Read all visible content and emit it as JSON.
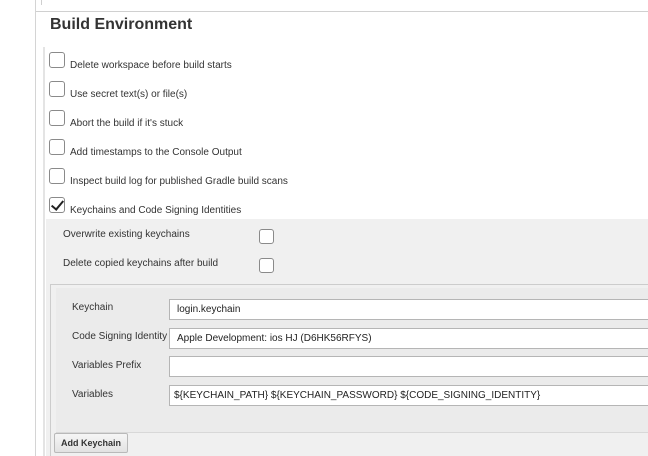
{
  "section": {
    "title": "Build Environment"
  },
  "options": [
    {
      "label": "Delete workspace before build starts",
      "checked": false
    },
    {
      "label": "Use secret text(s) or file(s)",
      "checked": false
    },
    {
      "label": "Abort the build if it's stuck",
      "checked": false
    },
    {
      "label": "Add timestamps to the Console Output",
      "checked": false
    },
    {
      "label": "Inspect build log for published Gradle build scans",
      "checked": false
    },
    {
      "label": "Keychains and Code Signing Identities",
      "checked": true
    }
  ],
  "keychain_settings": {
    "overwrite_label": "Overwrite existing keychains",
    "overwrite_checked": false,
    "delete_label": "Delete copied keychains after build",
    "delete_checked": false
  },
  "keychain_entry": {
    "keychain_label": "Keychain",
    "keychain_value": "login.keychain",
    "identity_label": "Code Signing Identity",
    "identity_value": "Apple Development: ios HJ (D6HK56RFYS)",
    "prefix_label": "Variables Prefix",
    "prefix_value": "",
    "variables_label": "Variables",
    "variables_value": "${KEYCHAIN_PATH} ${KEYCHAIN_PASSWORD} ${CODE_SIGNING_IDENTITY}"
  },
  "add_keychain_label": "Add Keychain",
  "colors": {
    "panel": "#f0f0f0",
    "border": "#cccccc",
    "text": "#333333"
  },
  "icons": {
    "checked": "checkmark-icon"
  }
}
